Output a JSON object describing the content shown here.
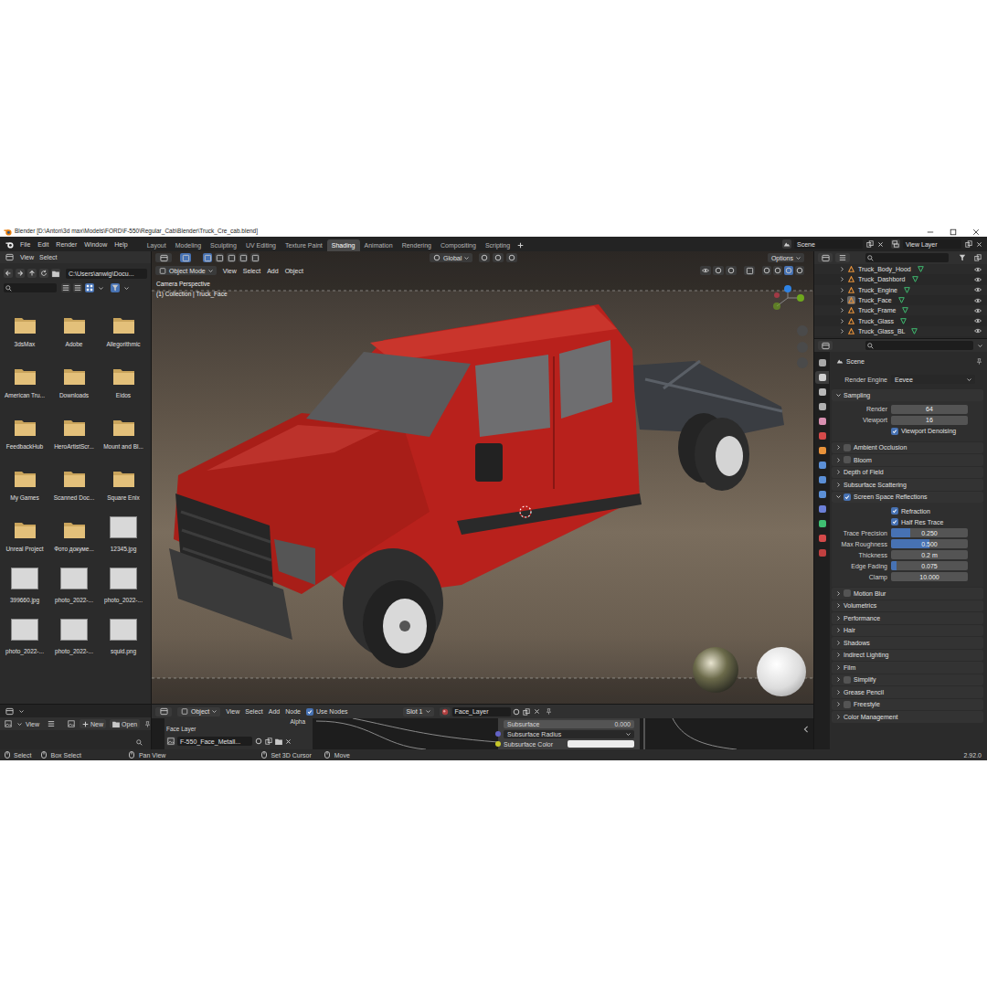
{
  "window": {
    "title": "Blender [D:\\Anton\\3d max\\Models\\FORD\\F-550\\Regular_Cab\\Blender\\Truck_Cre_cab.blend]"
  },
  "menu": [
    "File",
    "Edit",
    "Render",
    "Window",
    "Help"
  ],
  "workspaces": [
    {
      "label": "Layout",
      "selected": false
    },
    {
      "label": "Modeling",
      "selected": false
    },
    {
      "label": "Sculpting",
      "selected": false
    },
    {
      "label": "UV Editing",
      "selected": false
    },
    {
      "label": "Texture Paint",
      "selected": false
    },
    {
      "label": "Shading",
      "selected": true
    },
    {
      "label": "Animation",
      "selected": false
    },
    {
      "label": "Rendering",
      "selected": false
    },
    {
      "label": "Compositing",
      "selected": false
    },
    {
      "label": "Scripting",
      "selected": false
    }
  ],
  "scene": "Scene",
  "view_layer": "View Layer",
  "file_browser": {
    "menu": [
      "View",
      "Select"
    ],
    "path": "C:\\Users\\anwig\\Docu...",
    "items": [
      {
        "label": "3dsMax",
        "kind": "folder"
      },
      {
        "label": "Adobe",
        "kind": "folder"
      },
      {
        "label": "Allegorithmic",
        "kind": "folder"
      },
      {
        "label": "American Tru...",
        "kind": "folder"
      },
      {
        "label": "Downloads",
        "kind": "folder"
      },
      {
        "label": "Eidos",
        "kind": "folder"
      },
      {
        "label": "FeedbackHub",
        "kind": "folder"
      },
      {
        "label": "HeroArtistScr...",
        "kind": "folder"
      },
      {
        "label": "Mount and Bl...",
        "kind": "folder"
      },
      {
        "label": "My Games",
        "kind": "folder"
      },
      {
        "label": "Scanned Doc...",
        "kind": "folder"
      },
      {
        "label": "Square Enix",
        "kind": "folder"
      },
      {
        "label": "Unreal Project",
        "kind": "folder"
      },
      {
        "label": "Фото докуме...",
        "kind": "folder"
      },
      {
        "label": "12345.jpg",
        "kind": "image"
      },
      {
        "label": "399660.jpg",
        "kind": "image"
      },
      {
        "label": "photo_2022-...",
        "kind": "image"
      },
      {
        "label": "photo_2022-...",
        "kind": "image"
      },
      {
        "label": "photo_2022-...",
        "kind": "image"
      },
      {
        "label": "photo_2022-...",
        "kind": "image"
      },
      {
        "label": "squid.png",
        "kind": "image"
      }
    ]
  },
  "image_editor": {
    "menu": [
      "View"
    ],
    "new": "New",
    "open": "Open"
  },
  "viewport": {
    "mode": "Object Mode",
    "menu": [
      "View",
      "Select",
      "Add",
      "Object"
    ],
    "orientation": "Global",
    "options": "Options",
    "camera": "Camera Perspective",
    "collection": "(1) Collection | Truck_Face"
  },
  "node_editor": {
    "mode": "Object",
    "menu": [
      "View",
      "Select",
      "Add",
      "Node"
    ],
    "use_nodes": {
      "label": "Use Nodes",
      "checked": true
    },
    "slot": "Slot 1",
    "material": "Face_Layer",
    "image_node": {
      "label": "Face Layer",
      "image": "F-550_Face_Metall...",
      "output": "Alpha"
    },
    "sockets": [
      {
        "kind": "slider",
        "label": "Subsurface",
        "value": "0.000"
      },
      {
        "kind": "dropdown",
        "label": "Subsurface Radius"
      },
      {
        "kind": "color",
        "label": "Subsurface Color",
        "color": "#ececec"
      }
    ]
  },
  "outliner": {
    "items": [
      {
        "label": "Truck_Body_Hood",
        "selected": false
      },
      {
        "label": "Truck_Dashbord",
        "selected": false
      },
      {
        "label": "Truck_Engine",
        "selected": false
      },
      {
        "label": "Truck_Face",
        "selected": true
      },
      {
        "label": "Truck_Frame",
        "selected": false
      },
      {
        "label": "Truck_Glass",
        "selected": false
      },
      {
        "label": "Truck_Glass_BL",
        "selected": false
      }
    ]
  },
  "properties": {
    "tabs": [
      {
        "selected": false,
        "color": "#a8a8a8"
      },
      {
        "selected": true,
        "color": "#d0d0d0"
      },
      {
        "selected": false,
        "color": "#b8b8b8"
      },
      {
        "selected": false,
        "color": "#b0b0b0"
      },
      {
        "selected": false,
        "color": "#d88fb0"
      },
      {
        "selected": false,
        "color": "#d44a4a"
      },
      {
        "selected": false,
        "color": "#e8923a"
      },
      {
        "selected": false,
        "color": "#5b8fd6"
      },
      {
        "selected": false,
        "color": "#5b8fd6"
      },
      {
        "selected": false,
        "color": "#5b8fd6"
      },
      {
        "selected": false,
        "color": "#6b7fd6"
      },
      {
        "selected": false,
        "color": "#3fbf72"
      },
      {
        "selected": false,
        "color": "#d44a4a"
      },
      {
        "selected": false,
        "color": "#c04040"
      }
    ],
    "context": "Scene",
    "render_engine": {
      "label": "Render Engine",
      "value": "Eevee"
    },
    "sections": [
      {
        "label": "Sampling",
        "kind": "plain",
        "expanded": true,
        "rows": [
          {
            "kind": "field",
            "label": "Render",
            "value": "64"
          },
          {
            "kind": "field",
            "label": "Viewport",
            "value": "16"
          },
          {
            "kind": "checkbox",
            "label": "Viewport Denoising",
            "checked": true
          }
        ]
      },
      {
        "label": "Ambient Occlusion",
        "kind": "toggle",
        "checked": false,
        "expanded": false
      },
      {
        "label": "Bloom",
        "kind": "toggle",
        "checked": false,
        "expanded": false
      },
      {
        "label": "Depth of Field",
        "kind": "plain",
        "expanded": false
      },
      {
        "label": "Subsurface Scattering",
        "kind": "plain",
        "expanded": false
      },
      {
        "label": "Screen Space Reflections",
        "kind": "toggle",
        "checked": true,
        "expanded": true,
        "rows": [
          {
            "kind": "checkbox",
            "label": "Refraction",
            "checked": true
          },
          {
            "kind": "checkbox",
            "label": "Half Res Trace",
            "checked": true
          },
          {
            "kind": "slider",
            "label": "Trace Precision",
            "value": "0.250",
            "level": 0.25
          },
          {
            "kind": "slider",
            "label": "Max Roughness",
            "value": "0.500",
            "level": 0.5
          },
          {
            "kind": "field",
            "label": "Thickness",
            "value": "0.2 m"
          },
          {
            "kind": "slider",
            "label": "Edge Fading",
            "value": "0.075",
            "level": 0.075
          },
          {
            "kind": "field",
            "label": "Clamp",
            "value": "10.000"
          }
        ]
      },
      {
        "label": "Motion Blur",
        "kind": "toggle",
        "checked": false,
        "expanded": false
      },
      {
        "label": "Volumetrics",
        "kind": "plain",
        "expanded": false
      },
      {
        "label": "Performance",
        "kind": "plain",
        "expanded": false
      },
      {
        "label": "Hair",
        "kind": "plain",
        "expanded": false
      },
      {
        "label": "Shadows",
        "kind": "plain",
        "expanded": false
      },
      {
        "label": "Indirect Lighting",
        "kind": "plain",
        "expanded": false
      },
      {
        "label": "Film",
        "kind": "plain",
        "expanded": false
      },
      {
        "label": "Simplify",
        "kind": "toggle",
        "checked": false,
        "expanded": false
      },
      {
        "label": "Grease Pencil",
        "kind": "plain",
        "expanded": false
      },
      {
        "label": "Freestyle",
        "kind": "toggle",
        "checked": false,
        "expanded": false
      },
      {
        "label": "Color Management",
        "kind": "plain",
        "expanded": false
      }
    ]
  },
  "status_bar": {
    "items": [
      "Select",
      "Box Select",
      "Pan View",
      "Set 3D Cursor",
      "Move"
    ],
    "version": "2.92.0"
  }
}
